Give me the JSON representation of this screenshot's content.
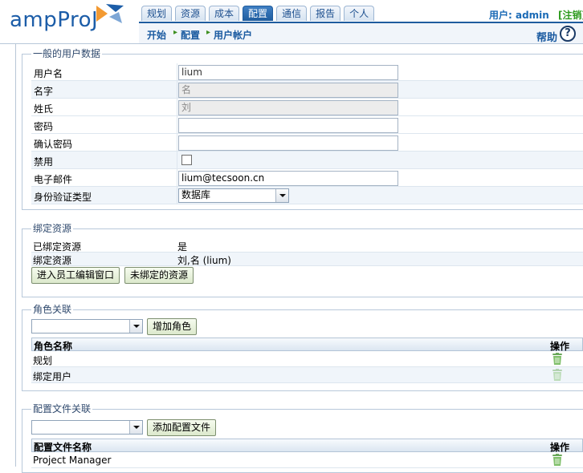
{
  "app": {
    "logo": "ampProJ"
  },
  "tabs": [
    "规划",
    "资源",
    "成本",
    "配置",
    "通信",
    "报告",
    "个人"
  ],
  "header": {
    "user_label": "用户: admin",
    "logout": "[注销]",
    "help": "帮助",
    "help_icon": "?"
  },
  "breadcrumb": [
    "开始",
    "配置",
    "用户帐户"
  ],
  "general": {
    "legend": "一般的用户数据",
    "fields": [
      {
        "label": "用户名",
        "type": "text",
        "value": "lium"
      },
      {
        "label": "名字",
        "type": "text",
        "value": "名",
        "disabled": true
      },
      {
        "label": "姓氏",
        "type": "text",
        "value": "刘",
        "disabled": true
      },
      {
        "label": "密码",
        "type": "password",
        "value": ""
      },
      {
        "label": "确认密码",
        "type": "password",
        "value": ""
      },
      {
        "label": "禁用",
        "type": "checkbox",
        "checked": false
      },
      {
        "label": "电子邮件",
        "type": "text",
        "value": "lium@tecsoon.cn"
      },
      {
        "label": "身份验证类型",
        "type": "select",
        "value": "数据库"
      }
    ]
  },
  "resource": {
    "legend": "绑定资源",
    "rows": [
      {
        "label": "已绑定资源",
        "value": "是"
      },
      {
        "label": "绑定资源",
        "value": "刘,名 (lium)"
      }
    ],
    "buttons": [
      "进入员工编辑窗口",
      "未绑定的资源"
    ]
  },
  "roles": {
    "legend": "角色关联",
    "select_value": "",
    "add_button": "增加角色",
    "columns": [
      "角色名称",
      "操作"
    ],
    "rows": [
      "规划",
      "绑定用户"
    ]
  },
  "profiles": {
    "legend": "配置文件关联",
    "select_value": "",
    "add_button": "添加配置文件",
    "columns": [
      "配置文件名称",
      "操作"
    ],
    "rows": [
      "Project Manager"
    ]
  },
  "colors": {
    "accent": "#1f5c9e",
    "row_alt": "#f0f5fa",
    "button": "#dce9cc",
    "trash": "#7fbf6a"
  }
}
